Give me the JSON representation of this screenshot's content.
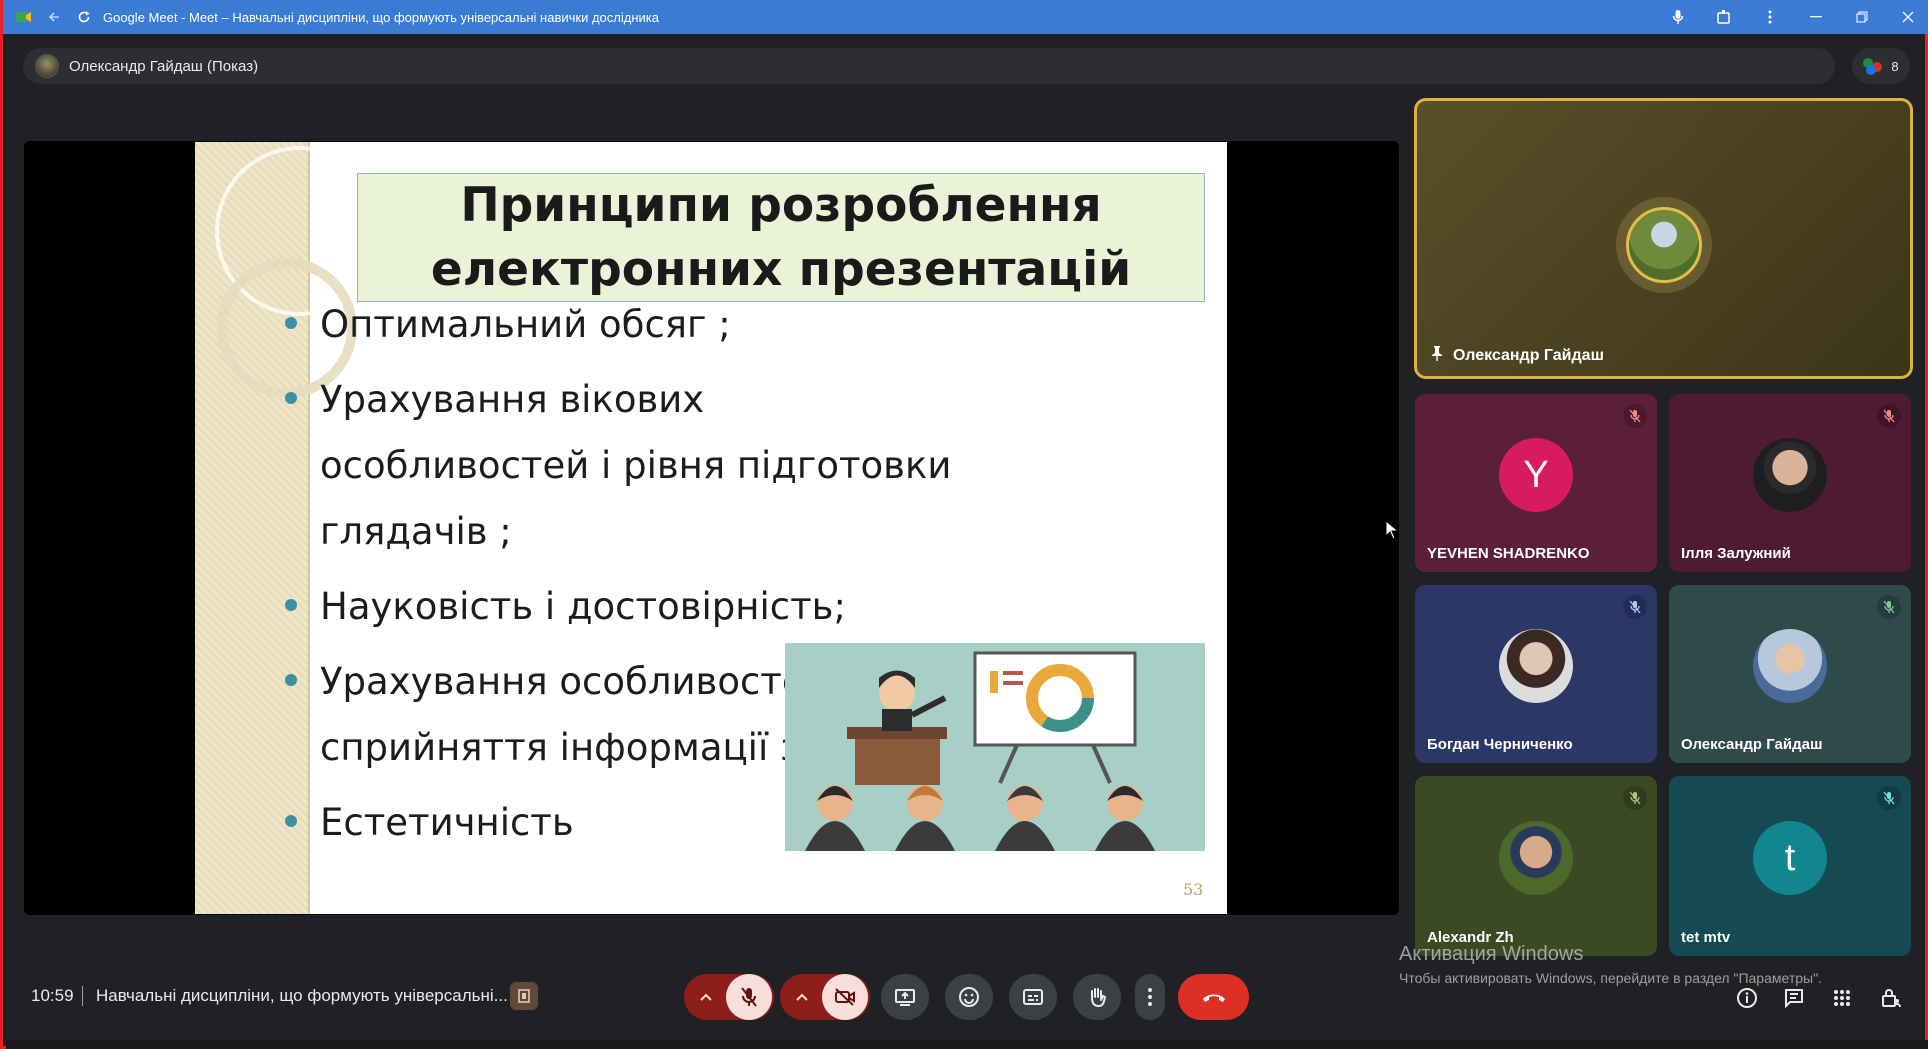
{
  "browser": {
    "title": "Google Meet - Meet – Навчальні дисципліни, що формують універсальні навички дослідника"
  },
  "presenter": {
    "label": "Олександр Гайдаш (Показ)",
    "participants_count": "8"
  },
  "slide": {
    "title": "Принципи розроблення електронних презентацій",
    "bullets": [
      "Оптимальний обсяг ;",
      "Урахування вікових особливостей і рівня підготовки глядачів ;",
      "Науковість і достовірність;",
      "Урахування особливостей сприйняття інформації з екрана;",
      " Естетичність"
    ],
    "page_number": "53"
  },
  "pinned_tile": {
    "name": "Олександр Гайдаш"
  },
  "tiles": [
    {
      "name": "YEVHEN SHADRENKO",
      "initial": "Y",
      "color": "#d81b60"
    },
    {
      "name": "Ілля Залужний"
    },
    {
      "name": "Богдан Черниченко"
    },
    {
      "name": "Олександр Гайдаш"
    },
    {
      "name": "Alexandr Zh"
    },
    {
      "name": "tet mtv",
      "initial": "t",
      "color": "#12868f"
    }
  ],
  "bottom_bar": {
    "time": "10:59",
    "meeting_title": "Навчальні дисципліни, що формують універсальні..."
  },
  "windows_activation": {
    "title": "Активация Windows",
    "subtitle": "Чтобы активировать Windows, перейдите в раздел \"Параметры\"."
  },
  "colors": {
    "titlebar": "#3b7bd6",
    "pinned_border": "#d8b53e",
    "end_call": "#dc3025",
    "muted_red": "#8c1d18"
  }
}
